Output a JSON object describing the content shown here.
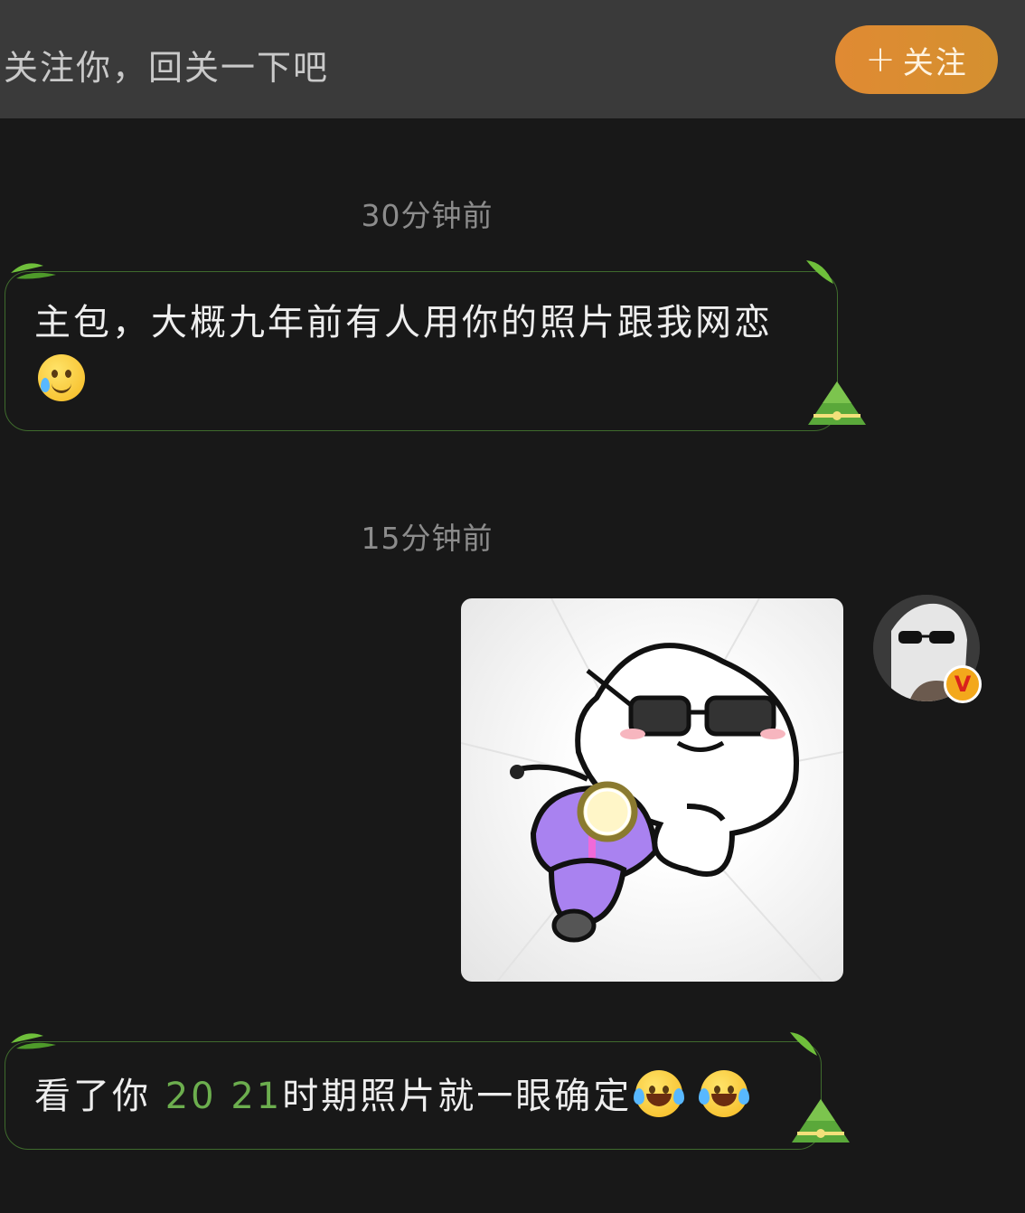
{
  "header": {
    "prompt": "关注你，回关一下吧",
    "follow_plus": "+",
    "follow_label": "关注"
  },
  "messages": [
    {
      "time": "30分钟前",
      "text": "主包，大概九年前有人用你的照片跟我网恋",
      "emoji": "tear-smile-icon"
    },
    {
      "time": "15分钟前",
      "sticker": "scooter-sticker",
      "from": "me"
    },
    {
      "text_before": "看了你",
      "year1": "20",
      "year2": "21",
      "text_after": "时期照片就一眼确定",
      "emoji": "laugh-cry-icon"
    }
  ],
  "avatar": {
    "badge": "V"
  },
  "colors": {
    "accent": "#e08a33",
    "bubble_border": "#3f6b2d",
    "year_link": "#6cae4e"
  }
}
